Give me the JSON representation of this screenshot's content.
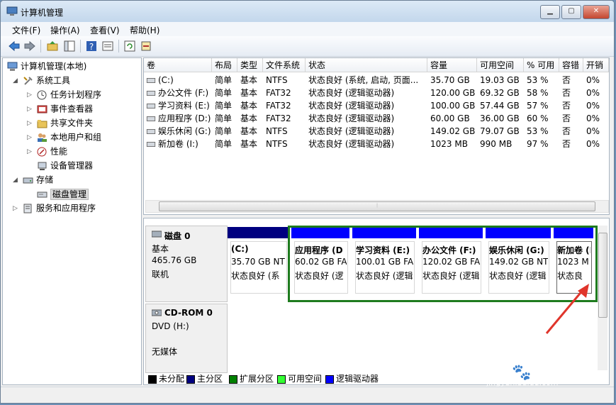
{
  "window": {
    "title": "计算机管理"
  },
  "menu": [
    "文件(F)",
    "操作(A)",
    "查看(V)",
    "帮助(H)"
  ],
  "tree": {
    "root": "计算机管理(本地)",
    "system_tools": "系统工具",
    "task_scheduler": "任务计划程序",
    "event_viewer": "事件查看器",
    "shared_folders": "共享文件夹",
    "local_users": "本地用户和组",
    "performance": "性能",
    "device_manager": "设备管理器",
    "storage": "存储",
    "disk_management": "磁盘管理",
    "services_apps": "服务和应用程序"
  },
  "volume_table": {
    "headers": [
      "卷",
      "布局",
      "类型",
      "文件系统",
      "状态",
      "容量",
      "可用空间",
      "% 可用",
      "容错",
      "开销"
    ],
    "rows": [
      [
        "(C:)",
        "简单",
        "基本",
        "NTFS",
        "状态良好 (系统, 启动, 页面...",
        "35.70 GB",
        "19.03 GB",
        "53 %",
        "否",
        "0%"
      ],
      [
        "办公文件 (F:)",
        "简单",
        "基本",
        "FAT32",
        "状态良好 (逻辑驱动器)",
        "120.00 GB",
        "69.32 GB",
        "58 %",
        "否",
        "0%"
      ],
      [
        "学习资料 (E:)",
        "简单",
        "基本",
        "FAT32",
        "状态良好 (逻辑驱动器)",
        "100.00 GB",
        "57.44 GB",
        "57 %",
        "否",
        "0%"
      ],
      [
        "应用程序 (D:)",
        "简单",
        "基本",
        "FAT32",
        "状态良好 (逻辑驱动器)",
        "60.00 GB",
        "36.00 GB",
        "60 %",
        "否",
        "0%"
      ],
      [
        "娱乐休闲 (G:)",
        "简单",
        "基本",
        "NTFS",
        "状态良好 (逻辑驱动器)",
        "149.02 GB",
        "79.07 GB",
        "53 %",
        "否",
        "0%"
      ],
      [
        "新加卷 (I:)",
        "简单",
        "基本",
        "NTFS",
        "状态良好 (逻辑驱动器)",
        "1023 MB",
        "990 MB",
        "97 %",
        "否",
        "0%"
      ]
    ]
  },
  "disk0": {
    "name": "磁盘 0",
    "type": "基本",
    "size": "465.76 GB",
    "status": "联机",
    "partitions": [
      {
        "name": "(C:)",
        "size": "35.70 GB NT",
        "status": "状态良好 (系"
      },
      {
        "name": "应用程序 (D",
        "size": "60.02 GB FA",
        "status": "状态良好 (逻"
      },
      {
        "name": "学习资料 (E:)",
        "size": "100.01 GB FA",
        "status": "状态良好 (逻辑"
      },
      {
        "name": "办公文件 (F:)",
        "size": "120.02 GB FA",
        "status": "状态良好 (逻辑"
      },
      {
        "name": "娱乐休闲 (G:)",
        "size": "149.02 GB NT",
        "status": "状态良好 (逻辑"
      },
      {
        "name": "新加卷 (I:)",
        "size": "1023 M",
        "status": "状态良"
      }
    ]
  },
  "cdrom": {
    "name": "CD-ROM 0",
    "drive": "DVD (H:)",
    "status": "无媒体"
  },
  "legend": [
    "未分配",
    "主分区",
    "扩展分区",
    "可用空间",
    "逻辑驱动器"
  ],
  "colors": {
    "unallocated": "#000000",
    "primary": "#000080",
    "extended": "#008000",
    "free": "#33ff33",
    "logical": "#0000ff",
    "annotation_arrow": "#e0352b"
  },
  "watermark": {
    "logo": "Baidu 经验",
    "url": "jingyan.baidu.com"
  }
}
